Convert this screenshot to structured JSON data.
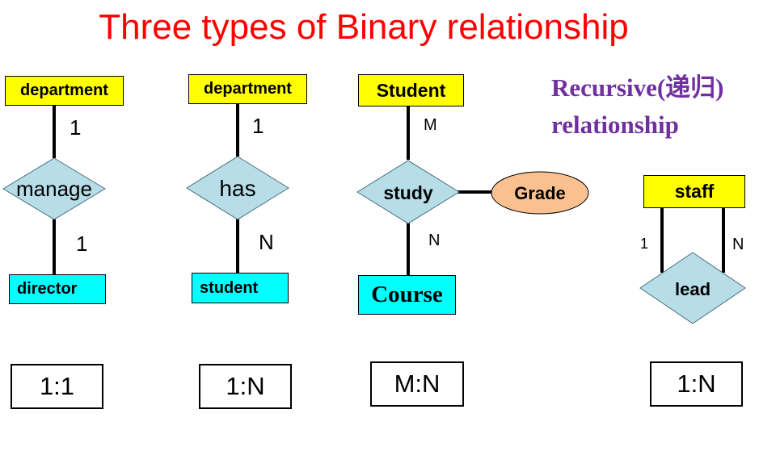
{
  "title": "Three types of Binary relationship",
  "recursive_title": "Recursive(递归) relationship",
  "colors": {
    "title": "#ff0000",
    "recursive_title": "#7030a0",
    "entity_yellow": "#ffff00",
    "entity_cyan": "#00ffff",
    "relationship_fill": "#b7dde8",
    "attribute_fill": "#fac090"
  },
  "one_to_one": {
    "entity_top": "department",
    "relationship": "manage",
    "entity_bottom": "director",
    "card_top": "1",
    "card_bottom": "1",
    "ratio": "1:1"
  },
  "one_to_many": {
    "entity_top": "department",
    "relationship": "has",
    "entity_bottom": "student",
    "card_top": "1",
    "card_bottom": "N",
    "ratio": "1:N"
  },
  "many_to_many": {
    "entity_top": "Student",
    "relationship": "study",
    "attribute": "Grade",
    "entity_bottom": "Course",
    "card_top": "M",
    "card_bottom": "N",
    "ratio": "M:N"
  },
  "recursive": {
    "entity": "staff",
    "relationship": "lead",
    "card_left": "1",
    "card_right": "N",
    "ratio": "1:N"
  }
}
